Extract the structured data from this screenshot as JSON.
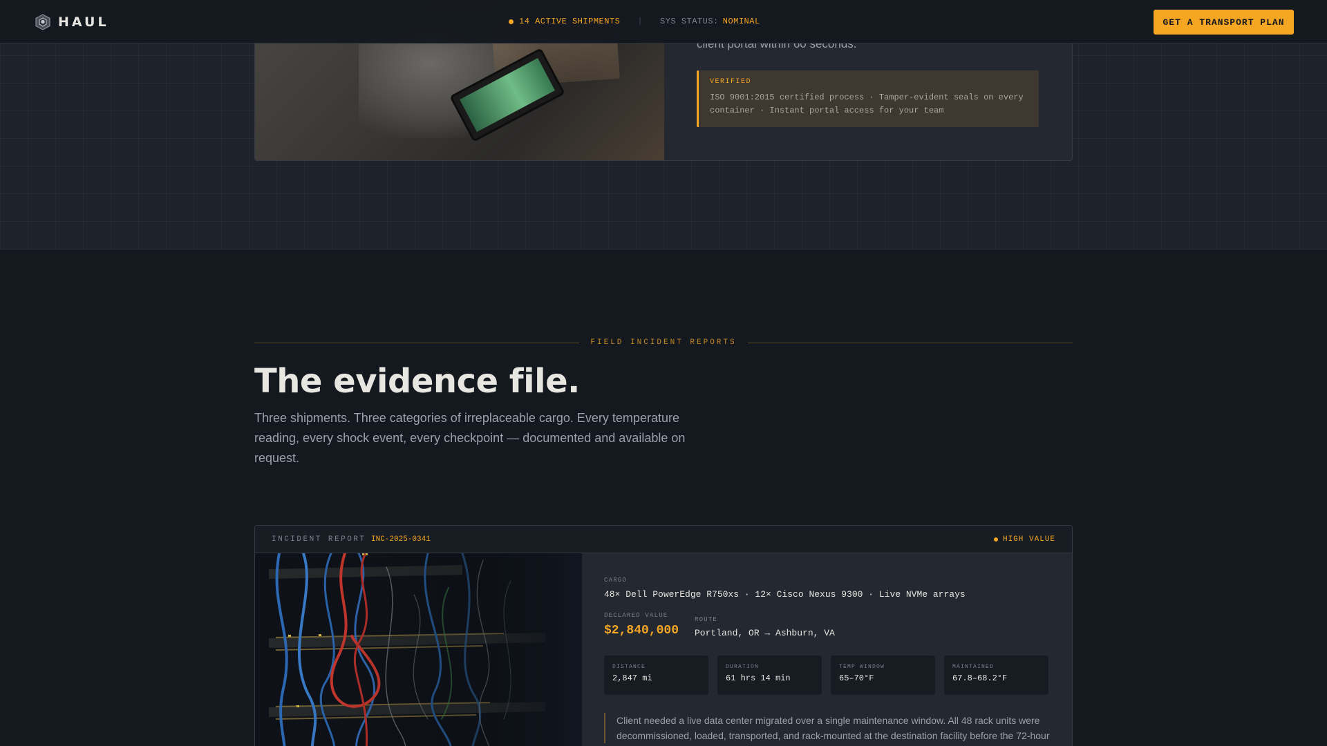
{
  "header": {
    "brand": "HAUL",
    "active_shipments": "14 ACTIVE SHIPMENTS",
    "sys_status_label": "SYS STATUS:",
    "sys_status_value": "NOMINAL",
    "cta_label": "GET A TRANSPORT PLAN"
  },
  "prev_section": {
    "body_tail": "client portal within 60 seconds.",
    "verified_label": "VERIFIED",
    "verified_text": "ISO 9001:2015 certified process · Tamper-evident seals on every container · Instant portal access for your team"
  },
  "evidence": {
    "eyebrow": "FIELD INCIDENT REPORTS",
    "title": "The evidence file.",
    "description": "Three shipments. Three categories of irreplaceable cargo. Every temperature reading, every shock event, every checkpoint — documented and available on request."
  },
  "report": {
    "label": "INCIDENT REPORT",
    "id": "INC-2025-0341",
    "badge": "HIGH VALUE",
    "cargo_label": "CARGO",
    "cargo": "48× Dell PowerEdge R750xs · 12× Cisco Nexus 9300 · Live NVMe arrays",
    "value_label": "DECLARED VALUE",
    "value": "$2,840,000",
    "route_label": "ROUTE",
    "route": "Portland, OR → Ashburn, VA",
    "stats": [
      {
        "label": "DISTANCE",
        "value": "2,847 mi"
      },
      {
        "label": "DURATION",
        "value": "61 hrs 14 min"
      },
      {
        "label": "TEMP WINDOW",
        "value": "65–70°F"
      },
      {
        "label": "MAINTAINED",
        "value": "67.8–68.2°F"
      }
    ],
    "quote": "Client needed a live data center migrated over a single maintenance window. All 48 rack units were decommissioned, loaded, transported, and rack-mounted at the destination facility before the 72-hour"
  },
  "colors": {
    "accent": "#f5a623",
    "background": "#14181f",
    "card": "#232831"
  }
}
